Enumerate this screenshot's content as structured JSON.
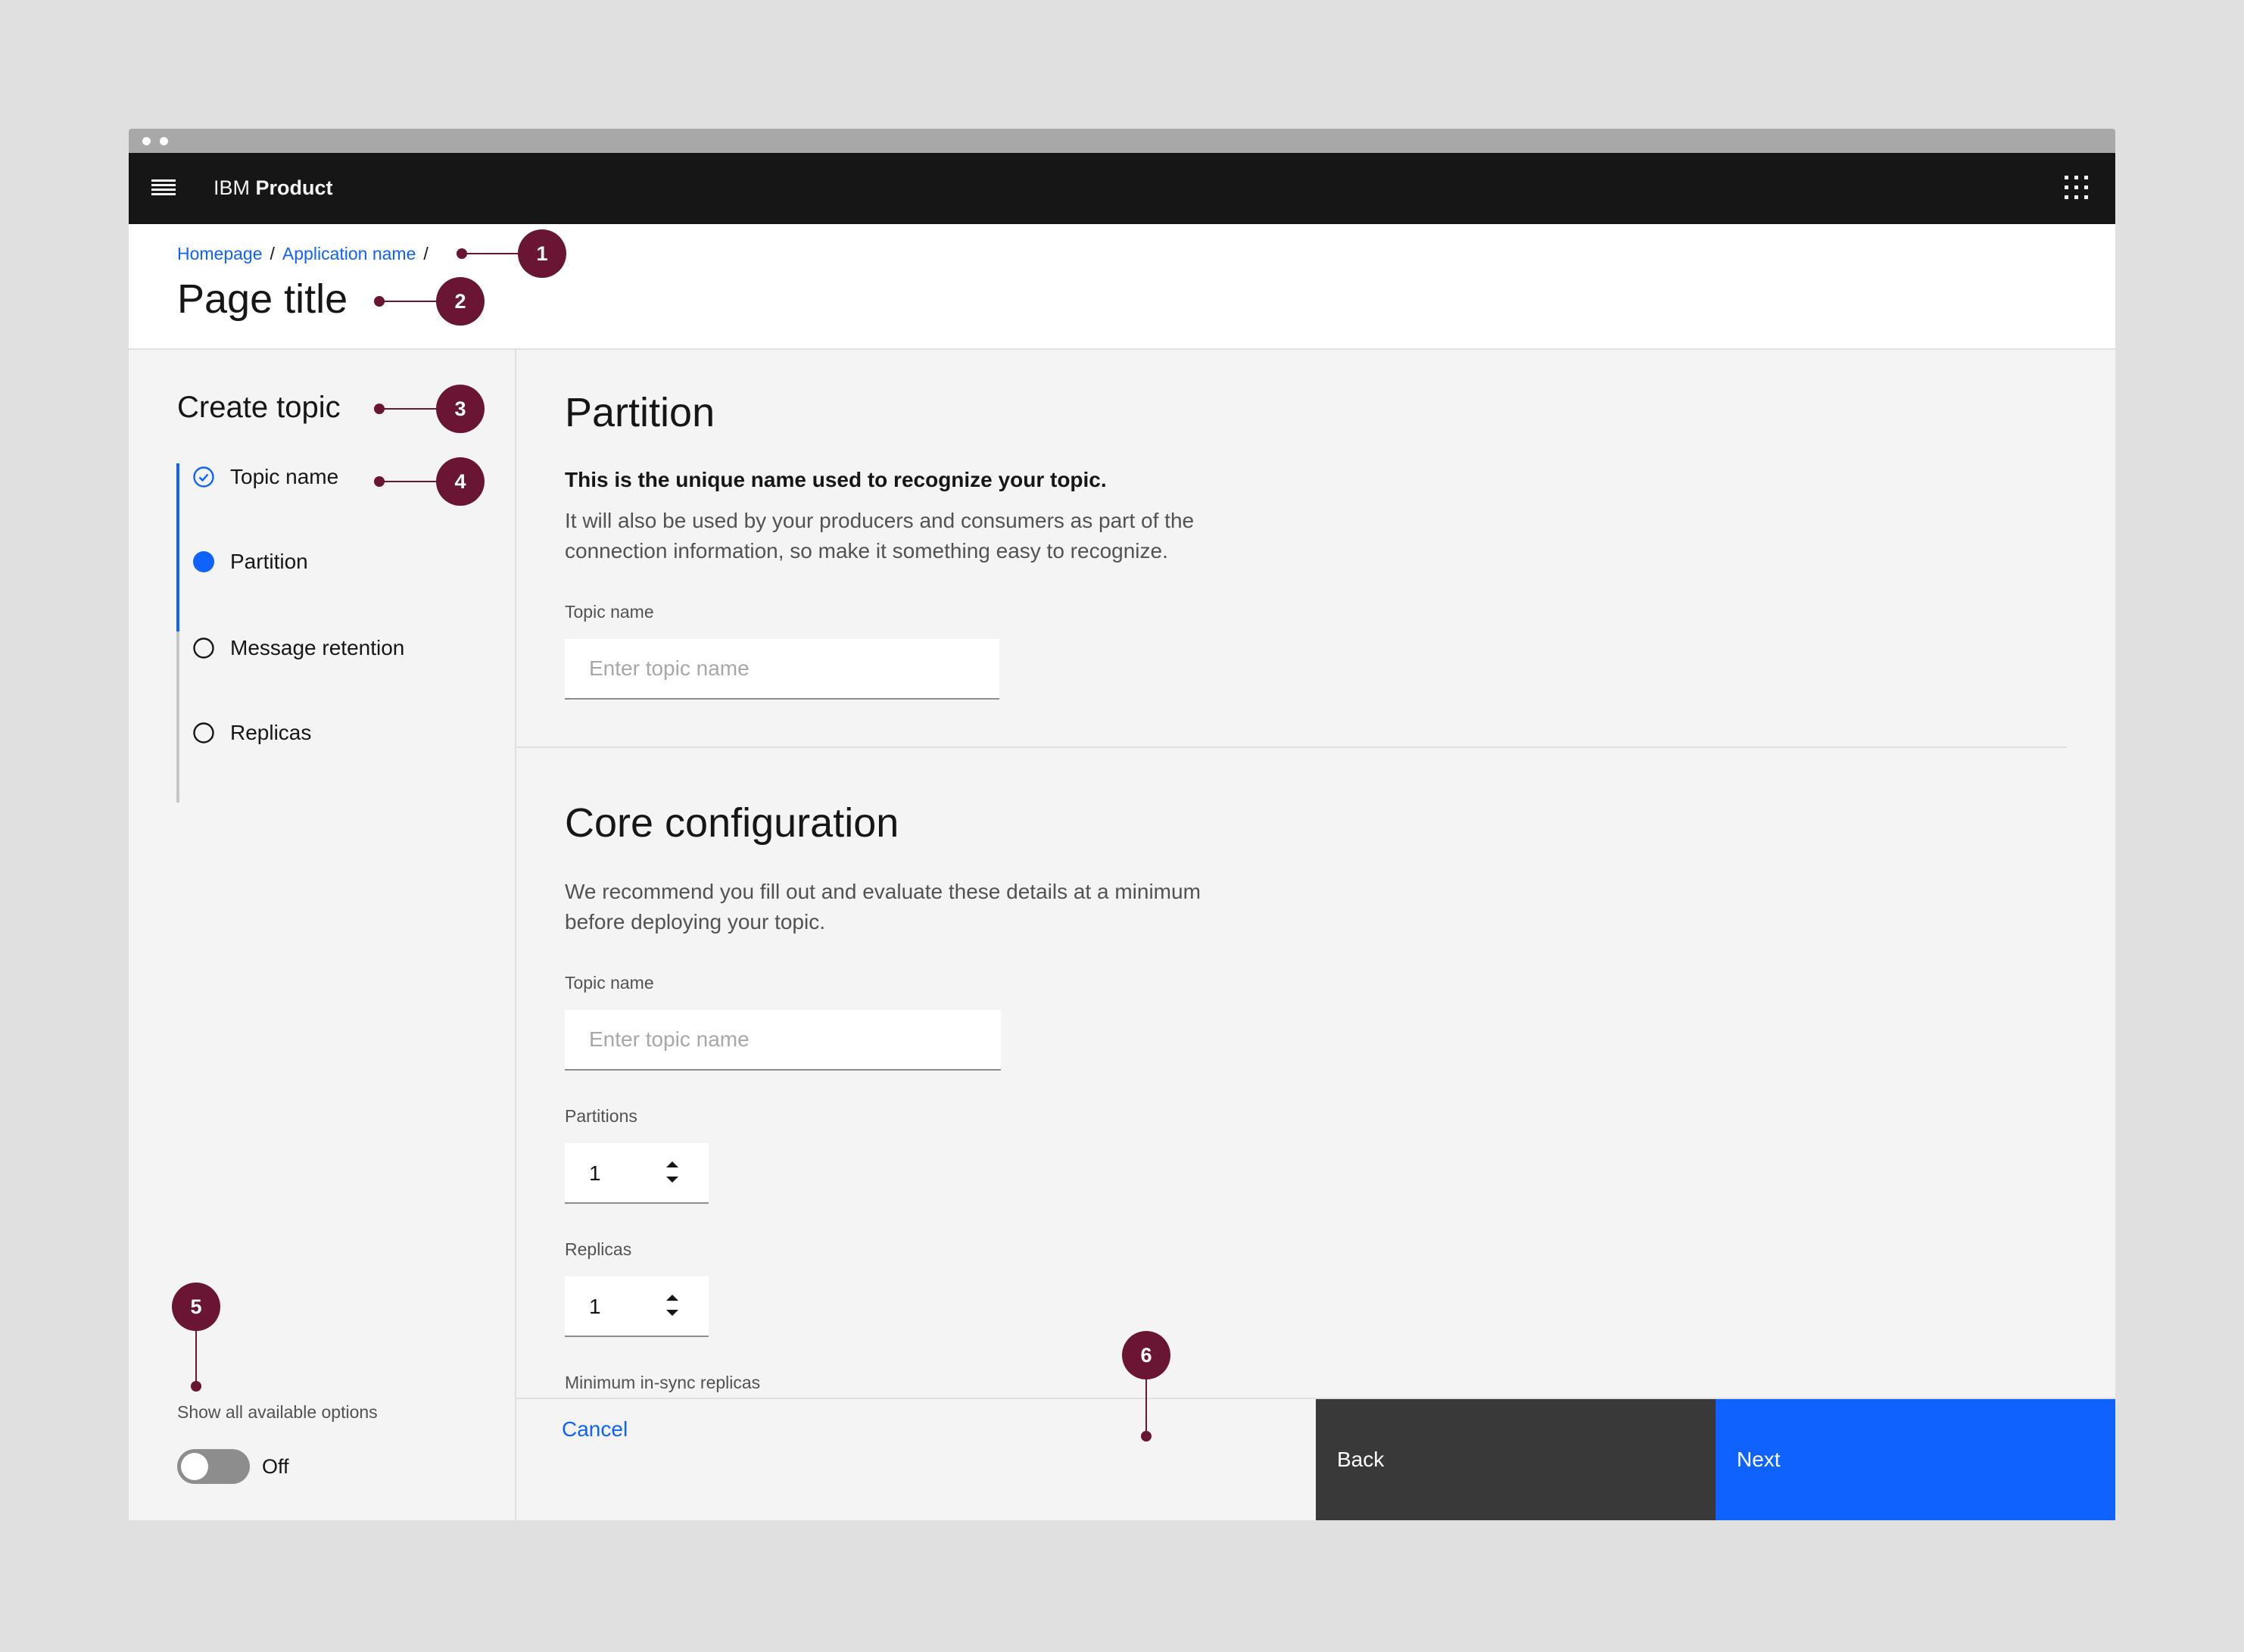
{
  "shell": {
    "brand_prefix": "IBM",
    "brand_name": "Product"
  },
  "breadcrumb": {
    "items": [
      "Homepage",
      "Application name"
    ],
    "separator": "/"
  },
  "page_title": "Page title",
  "side_panel": {
    "title": "Create topic",
    "steps": [
      {
        "label": "Topic name",
        "state": "complete"
      },
      {
        "label": "Partition",
        "state": "current"
      },
      {
        "label": "Message retention",
        "state": "incomplete"
      },
      {
        "label": "Replicas",
        "state": "incomplete"
      }
    ],
    "show_options_label": "Show all available options",
    "toggle_state": "Off"
  },
  "partition_section": {
    "title": "Partition",
    "lead": "This is the unique name used to recognize your topic.",
    "description_lines": [
      "It will also be used by your producers and consumers as part of the",
      "connection information, so make it something easy to recognize."
    ],
    "field_label": "Topic name",
    "field_placeholder": "Enter topic name"
  },
  "core_section": {
    "title": "Core configuration",
    "description_lines": [
      "We recommend you fill out and evaluate these details at a minimum",
      "before deploying your topic."
    ],
    "topic_label": "Topic name",
    "topic_placeholder": "Enter topic name",
    "partitions_label": "Partitions",
    "partitions_value": "1",
    "replicas_label": "Replicas",
    "replicas_value": "1",
    "min_insync_label": "Minimum in-sync replicas"
  },
  "footer": {
    "cancel_label": "Cancel",
    "back_label": "Back",
    "next_label": "Next"
  },
  "callouts": [
    "1",
    "2",
    "3",
    "4",
    "5",
    "6"
  ],
  "colors": {
    "shell_bg": "#161616",
    "primary": "#0f62fe",
    "secondary_button": "#393939",
    "callout": "#6a1533",
    "panel_bg": "#f4f4f4"
  }
}
